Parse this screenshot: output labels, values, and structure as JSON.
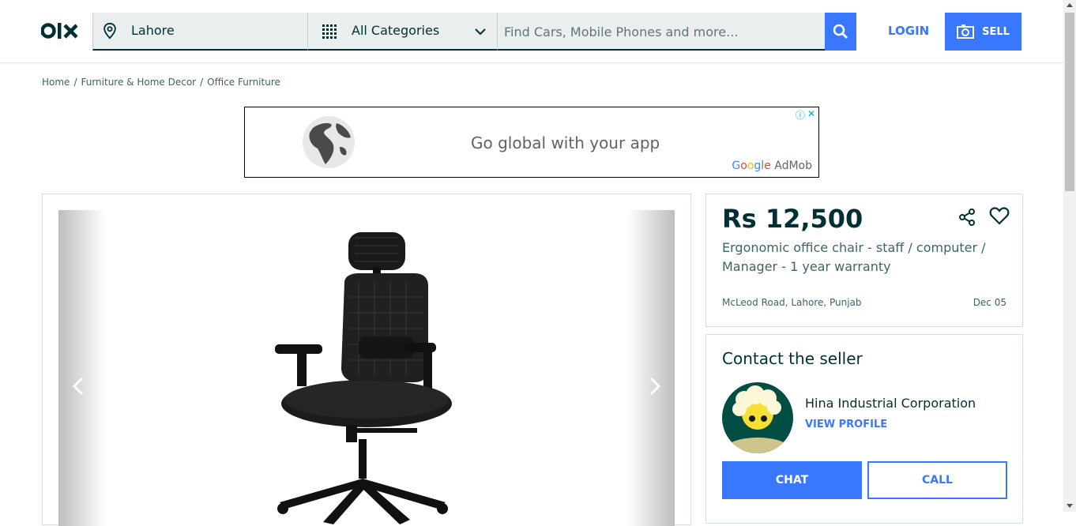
{
  "header": {
    "logo_text": "olx",
    "location": "Lahore",
    "category": "All Categories",
    "search_placeholder": "Find Cars, Mobile Phones and more...",
    "login_label": "LOGIN",
    "sell_label": "SELL"
  },
  "breadcrumb": [
    "Home",
    "Furniture & Home Decor",
    "Office Furniture"
  ],
  "ad": {
    "headline": "Go global with your app",
    "brand_google": [
      "G",
      "o",
      "o",
      "g",
      "l",
      "e"
    ],
    "brand_product": "AdMob"
  },
  "listing": {
    "price": "Rs 12,500",
    "title": "Ergonomic office chair - staff / computer / Manager - 1 year warranty",
    "location": "McLeod Road, Lahore, Punjab",
    "date": "Dec 05"
  },
  "seller": {
    "heading": "Contact the seller",
    "name": "Hina Industrial Corporation",
    "view_profile": "VIEW PROFILE",
    "chat_label": "CHAT",
    "call_label": "CALL"
  },
  "colors": {
    "primary": "#002f34",
    "accent": "#3a77ff",
    "muted": "#406367"
  },
  "icons": {
    "location": "location-pin-icon",
    "categories": "grid-icon",
    "search": "search-icon",
    "sell": "camera-icon",
    "share": "share-icon",
    "favorite": "heart-icon"
  }
}
